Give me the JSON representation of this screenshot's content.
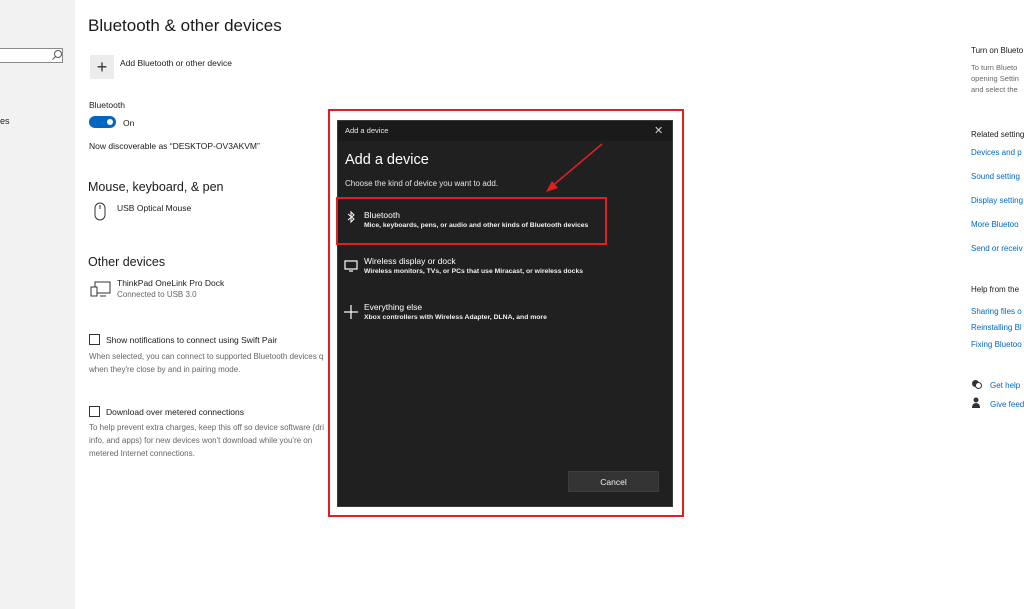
{
  "page": {
    "title": "Bluetooth & other devices",
    "add_device_label": "Add Bluetooth or other device",
    "side_fragment": "es"
  },
  "bluetooth": {
    "label": "Bluetooth",
    "state": "On",
    "discoverable": "Now discoverable as “DESKTOP-OV3AKVM”"
  },
  "mouse_section": {
    "heading": "Mouse, keyboard, & pen",
    "device_name": "USB Optical Mouse"
  },
  "other_section": {
    "heading": "Other devices",
    "device_name": "ThinkPad OneLink Pro Dock",
    "device_status": "Connected to USB 3.0"
  },
  "swift_pair": {
    "label": "Show notifications to connect using Swift Pair",
    "desc_line1": "When selected, you can connect to supported Bluetooth devices q",
    "desc_line2": "when they're close by and in pairing mode."
  },
  "metered": {
    "label": "Download over metered connections",
    "desc_line1": "To help prevent extra charges, keep this off so device software (dri",
    "desc_line2": "info, and apps) for new devices won't download while you're on",
    "desc_line3": "metered Internet connections."
  },
  "right_panel": {
    "turn_on_heading": "Turn on Blueto",
    "turn_on_line1": "To turn Blueto",
    "turn_on_line2": "opening Settin",
    "turn_on_line3": "and select the",
    "related_heading": "Related setting",
    "related_links": [
      "Devices and p",
      "Sound setting",
      "Display setting",
      "More Bluetoo",
      "Send or receiv"
    ],
    "help_heading": "Help from the",
    "help_links": [
      "Sharing files o",
      "Reinstalling Bl",
      "Fixing Bluetoo"
    ],
    "get_help": "Get help",
    "give_feedback": "Give feed"
  },
  "dialog": {
    "window_title": "Add a device",
    "heading": "Add a device",
    "subtitle": "Choose the kind of device you want to add.",
    "options": [
      {
        "title": "Bluetooth",
        "desc": "Mice, keyboards, pens, or audio and other kinds of Bluetooth devices",
        "icon": "bluetooth-icon"
      },
      {
        "title": "Wireless display or dock",
        "desc": "Wireless monitors, TVs, or PCs that use Miracast, or wireless docks",
        "icon": "monitor-icon"
      },
      {
        "title": "Everything else",
        "desc": "Xbox controllers with Wireless Adapter, DLNA, and more",
        "icon": "plus-icon"
      }
    ],
    "cancel_label": "Cancel"
  },
  "colors": {
    "accent": "#0067c0",
    "highlight": "#e02020",
    "dialog_bg": "#202020"
  }
}
